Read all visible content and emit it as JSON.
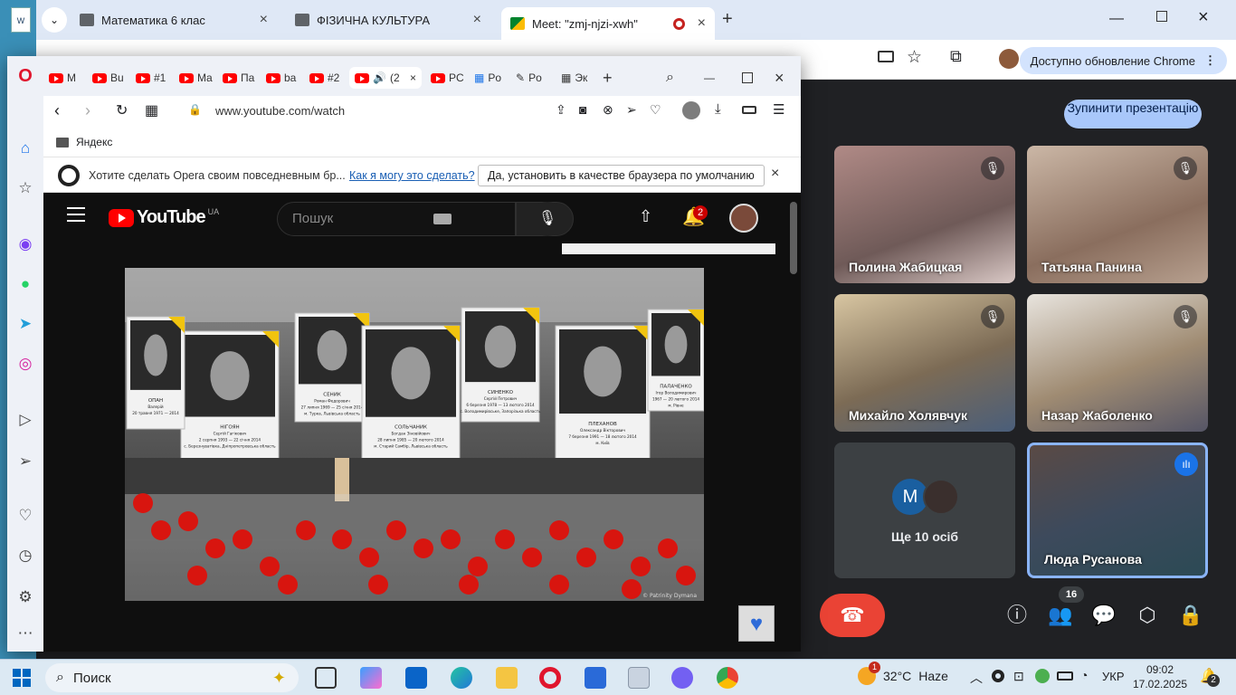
{
  "chrome": {
    "tabs": [
      {
        "label": "Математика 6 клас"
      },
      {
        "label": "ФІЗИЧНА КУЛЬТУРА"
      },
      {
        "label": "Meet: \"zmj-njzi-xwh\""
      }
    ],
    "new_tab": "+",
    "update_label": "Доступно обновление Chrome"
  },
  "meet": {
    "stop_presenting": "Зупинити презентацію",
    "participants": [
      {
        "name": "Полина Жабицкая"
      },
      {
        "name": "Татьяна Панина"
      },
      {
        "name": "Михайло Холявчук"
      },
      {
        "name": "Назар Жаболенко"
      },
      {
        "name": "Люда Русанова"
      }
    ],
    "others": {
      "label": "Ще 10 осіб",
      "avatar_letter": "M"
    },
    "participant_count": "16",
    "colors": {
      "accent": "#a8c7fa",
      "hangup": "#ea4335",
      "tile_bg": "#3c4043"
    }
  },
  "opera": {
    "tabs": [
      "M",
      "Bu",
      "#1",
      "Ma",
      "Па",
      "ba",
      "#2",
      "(2",
      "PC",
      "Po",
      "Po",
      "Эк"
    ],
    "url": "www.youtube.com/watch",
    "bookmark": "Яндекс",
    "banner": {
      "text": "Хотите сделать Opera своим повседневным бр...",
      "link": "Как я могу это сделать?",
      "button": "Да, установить в качестве браузера по умолчанию",
      "close": "×"
    }
  },
  "youtube": {
    "logo": "YouTube",
    "region": "UA",
    "search_placeholder": "Пошук",
    "notif_count": "2",
    "watermark": "© Patrinity Dymana"
  },
  "video_captions": [
    {
      "name": "НІГОЯН",
      "sub": "Сергій Гагікович",
      "dates": "2 серпня 1993 — 22 січня 2014",
      "place": "с. Березнуватівка, Дніпропетровська область"
    },
    {
      "name": "СЕНИК",
      "sub": "Роман Федорович",
      "dates": "27 липня 1969 — 25 січня 2014",
      "place": "м. Турка, Львівська область"
    },
    {
      "name": "СОЛЬЧАНИК",
      "sub": "Богдан Зіновійович",
      "dates": "28 липня 1985 — 20 лютого 2014",
      "place": "м. Старий Самбір, Львівська область"
    },
    {
      "name": "СИНЕНКО",
      "sub": "Сергій Петрович",
      "dates": "6 березня 1978 — 13 лютого 2014",
      "place": "с. Володимирівське, Запорізька область"
    },
    {
      "name": "ПЛЕХАНОВ",
      "sub": "Олександр Вікторович",
      "dates": "7 березня 1991 — 18 лютого 2014",
      "place": "м. Київ"
    },
    {
      "name": "ПАЛАЧЕНКО",
      "sub": "Ігор Володимирович",
      "dates": "1967 — 20 лютого 2014",
      "place": "м. Рівне"
    },
    {
      "name": "ОПАН",
      "sub": "Валерій",
      "dates": "20 травня 1971 — 2014",
      "place": ""
    }
  ],
  "taskbar": {
    "search": "Поиск",
    "temp": "32°C",
    "weather": "Haze",
    "weather_badge": "1",
    "lang": "УКР",
    "time": "09:02",
    "date": "17.02.2025",
    "notif_count": "2"
  }
}
